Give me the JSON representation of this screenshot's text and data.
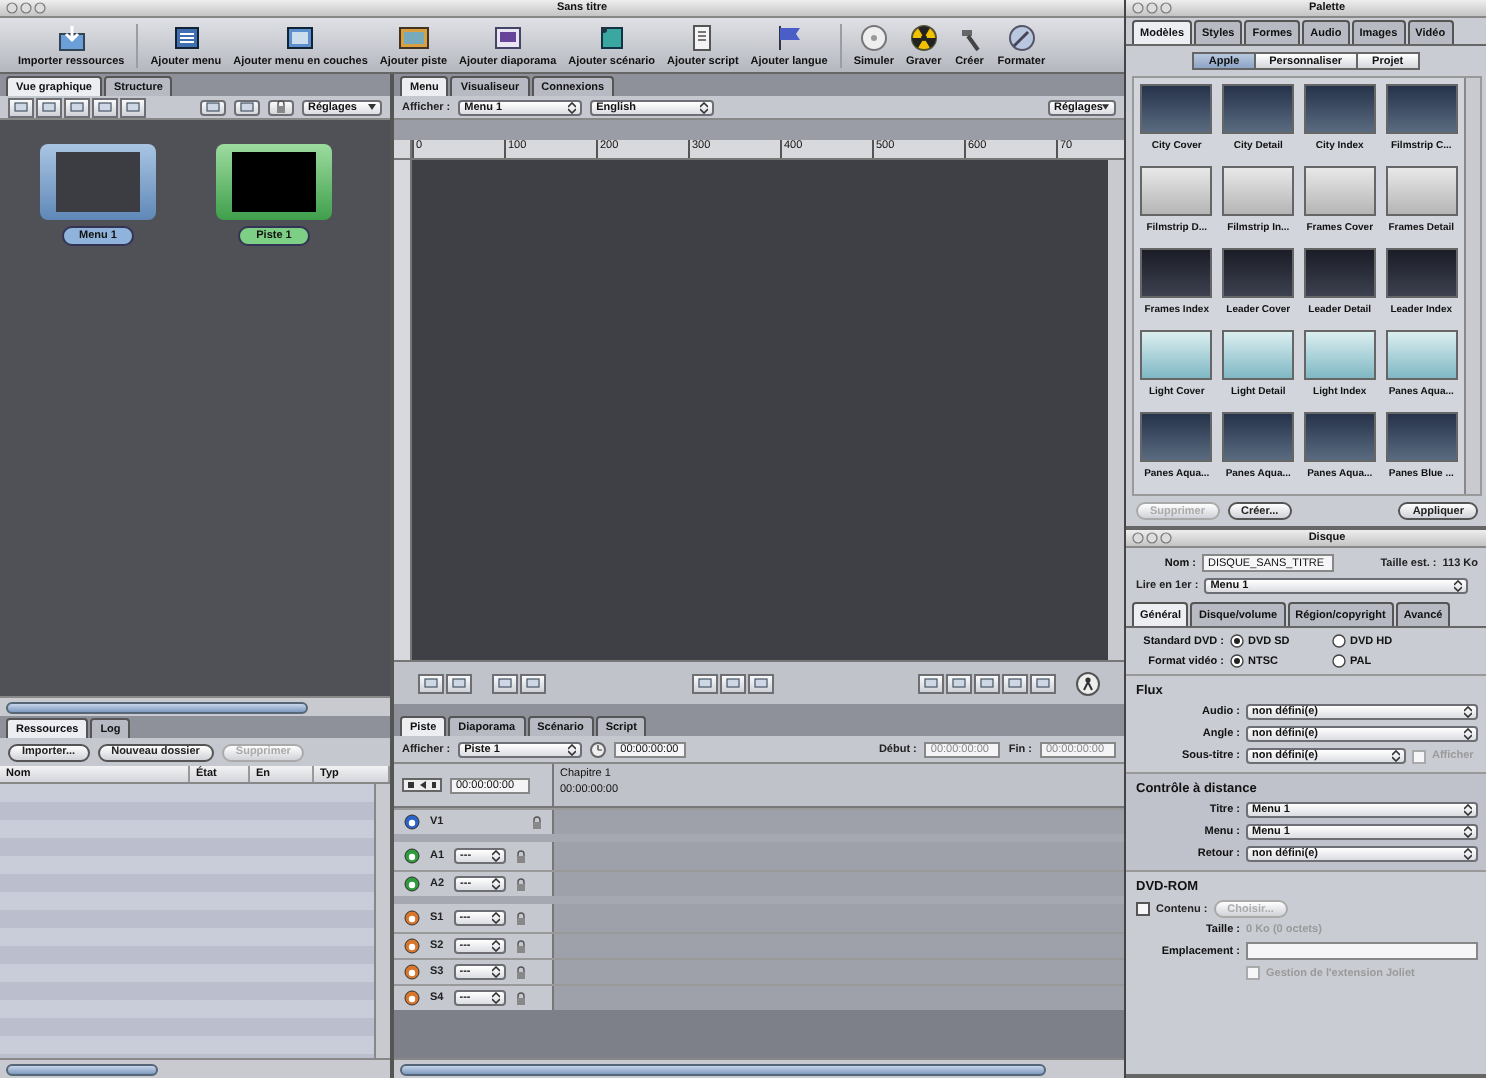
{
  "window": {
    "title": "Sans titre"
  },
  "toolbar": {
    "groups": [
      {
        "items": [
          {
            "label": "Importer ressources",
            "kind": "import"
          }
        ]
      },
      {
        "items": [
          {
            "label": "Ajouter menu",
            "kind": "menu"
          },
          {
            "label": "Ajouter menu en couches",
            "kind": "layered"
          },
          {
            "label": "Ajouter piste",
            "kind": "track"
          },
          {
            "label": "Ajouter diaporama",
            "kind": "slideshow"
          },
          {
            "label": "Ajouter scénario",
            "kind": "story"
          },
          {
            "label": "Ajouter script",
            "kind": "script"
          },
          {
            "label": "Ajouter langue",
            "kind": "flag"
          }
        ]
      },
      {
        "items": [
          {
            "label": "Simuler",
            "kind": "disc"
          },
          {
            "label": "Graver",
            "kind": "burn"
          },
          {
            "label": "Créer",
            "kind": "hammer"
          },
          {
            "label": "Formater",
            "kind": "format"
          }
        ]
      }
    ]
  },
  "graphic_view": {
    "tabs": [
      {
        "label": "Vue graphique",
        "selected": true
      },
      {
        "label": "Structure",
        "selected": false
      }
    ],
    "settings": "Réglages",
    "nodes": [
      {
        "label": "Menu 1",
        "kind": "menu"
      },
      {
        "label": "Piste 1",
        "kind": "track"
      }
    ]
  },
  "editor": {
    "tabs": [
      {
        "label": "Menu",
        "selected": true
      },
      {
        "label": "Visualiseur",
        "selected": false
      },
      {
        "label": "Connexions",
        "selected": false
      }
    ],
    "show_label": "Afficher :",
    "menu": "Menu 1",
    "language": "English",
    "settings": "Réglages",
    "ruler": [
      "0",
      "100",
      "200",
      "300",
      "400",
      "500",
      "600",
      "70"
    ]
  },
  "resources": {
    "tabs": [
      {
        "label": "Ressources",
        "selected": true
      },
      {
        "label": "Log",
        "selected": false
      }
    ],
    "buttons": [
      {
        "label": "Importer...",
        "disabled": false
      },
      {
        "label": "Nouveau dossier",
        "disabled": false
      },
      {
        "label": "Supprimer",
        "disabled": true
      }
    ],
    "columns": [
      "Nom",
      "État",
      "En",
      "Typ"
    ]
  },
  "timeline": {
    "tabs": [
      {
        "label": "Piste",
        "selected": true
      },
      {
        "label": "Diaporama",
        "selected": false
      },
      {
        "label": "Scénario",
        "selected": false
      },
      {
        "label": "Script",
        "selected": false
      }
    ],
    "show_label": "Afficher :",
    "track": "Piste 1",
    "timecode": "00:00:00:00",
    "start_label": "Début :",
    "start": "00:00:00:00",
    "end_label": "Fin :",
    "end": "00:00:00:00",
    "header_time": "00:00:00:00",
    "marker": "Chapitre 1",
    "marker_time": "00:00:00:00",
    "tracks": [
      {
        "name": "V1",
        "kind": "video"
      },
      {
        "name": "A1",
        "kind": "audio",
        "stream": "---"
      },
      {
        "name": "A2",
        "kind": "audio",
        "stream": "---"
      },
      {
        "name": "S1",
        "kind": "subtitle",
        "stream": "---"
      },
      {
        "name": "S2",
        "kind": "subtitle",
        "stream": "---"
      },
      {
        "name": "S3",
        "kind": "subtitle",
        "stream": "---"
      },
      {
        "name": "S4",
        "kind": "subtitle",
        "stream": "---"
      }
    ]
  },
  "palette": {
    "title": "Palette",
    "tabs": [
      {
        "label": "Modèles",
        "selected": true
      },
      {
        "label": "Styles",
        "selected": false
      },
      {
        "label": "Formes",
        "selected": false
      },
      {
        "label": "Audio",
        "selected": false
      },
      {
        "label": "Images",
        "selected": false
      },
      {
        "label": "Vidéo",
        "selected": false
      }
    ],
    "segments": [
      {
        "label": "Apple",
        "selected": true
      },
      {
        "label": "Personnaliser",
        "selected": false
      },
      {
        "label": "Projet",
        "selected": false
      }
    ],
    "templates": [
      "City Cover",
      "City Detail",
      "City Index",
      "Filmstrip C...",
      "Filmstrip D...",
      "Filmstrip In...",
      "Frames Cover",
      "Frames Detail",
      "Frames Index",
      "Leader Cover",
      "Leader Detail",
      "Leader Index",
      "Light Cover",
      "Light Detail",
      "Light Index",
      "Panes Aqua...",
      "Panes Aqua...",
      "Panes Aqua...",
      "Panes Aqua...",
      "Panes Blue ..."
    ],
    "buttons": [
      {
        "label": "Supprimer",
        "disabled": true
      },
      {
        "label": "Créer...",
        "disabled": false
      },
      {
        "label": "Appliquer",
        "disabled": false
      }
    ]
  },
  "disc": {
    "title": "Disque",
    "name_label": "Nom :",
    "name": "DISQUE_SANS_TITRE",
    "size_label": "Taille est. :",
    "size": "113 Ko",
    "first_play_label": "Lire en 1er :",
    "first_play": "Menu 1",
    "tabs": [
      {
        "label": "Général",
        "selected": true
      },
      {
        "label": "Disque/volume",
        "selected": false
      },
      {
        "label": "Région/copyright",
        "selected": false
      },
      {
        "label": "Avancé",
        "selected": false
      }
    ],
    "radio_rows": [
      {
        "label": "Standard DVD :",
        "options": [
          {
            "label": "DVD SD",
            "selected": true
          },
          {
            "label": "DVD HD",
            "selected": false
          }
        ]
      },
      {
        "label": "Format vidéo :",
        "options": [
          {
            "label": "NTSC",
            "selected": true
          },
          {
            "label": "PAL",
            "selected": false
          }
        ]
      }
    ],
    "sections": [
      {
        "title": "Flux",
        "rows": [
          {
            "label": "Audio :",
            "value": "non défini(e)"
          },
          {
            "label": "Angle :",
            "value": "non défini(e)"
          },
          {
            "label": "Sous-titre :",
            "value": "non défini(e)",
            "checkbox": {
              "label": "Afficher",
              "checked": false,
              "disabled": true
            }
          }
        ]
      },
      {
        "title": "Contrôle à distance",
        "rows": [
          {
            "label": "Titre :",
            "value": "Menu 1"
          },
          {
            "label": "Menu :",
            "value": "Menu 1"
          },
          {
            "label": "Retour :",
            "value": "non défini(e)"
          }
        ]
      }
    ],
    "dvdrom": {
      "title": "DVD-ROM",
      "content_label": "Contenu :",
      "content_checked": false,
      "choose": "Choisir...",
      "size_label": "Taille :",
      "size": "0 Ko (0 octets)",
      "location_label": "Emplacement :",
      "joliet": {
        "label": "Gestion de l'extension Joliet",
        "checked": false
      }
    }
  }
}
